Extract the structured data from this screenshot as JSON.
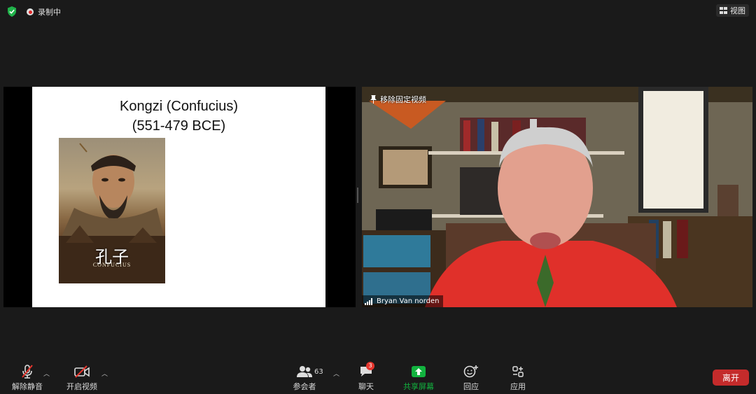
{
  "top": {
    "recording_label": "录制中",
    "view_label": "视图"
  },
  "share": {
    "slide_title": "Kongzi (Confucius)",
    "slide_dates": "(551-479 BCE)",
    "poster_title_cn": "孔子",
    "poster_title_en": "CONFUCIUS"
  },
  "video": {
    "unpin_label": "移除固定视频",
    "participant_name": "Bryan Van norden"
  },
  "toolbar": {
    "unmute_label": "解除静音",
    "start_video_label": "开启视频",
    "participants_label": "参会者",
    "participants_count": "63",
    "chat_label": "聊天",
    "chat_badge": "3",
    "share_screen_label": "共享屏幕",
    "reactions_label": "回应",
    "apps_label": "应用",
    "leave_label": "离开"
  },
  "colors": {
    "background": "#1a1a1a",
    "share_green": "#12b33f",
    "leave_red": "#c42b2b",
    "badge_red": "#e5352d"
  }
}
